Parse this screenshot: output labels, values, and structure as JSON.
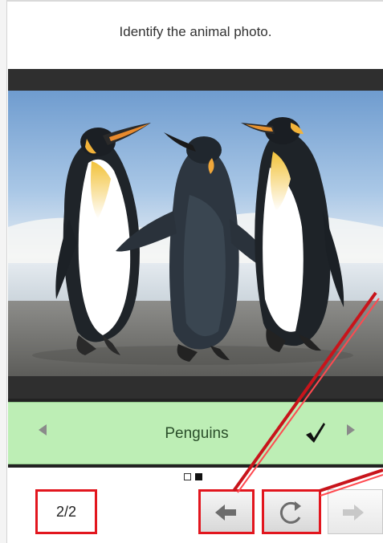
{
  "prompt": "Identify the animal photo.",
  "photo": {
    "subject": "penguins-photo"
  },
  "answer_bar": {
    "label": "Penguins",
    "prev_icon": "triangle-left-icon",
    "next_icon": "triangle-right-icon",
    "check_icon": "checkmark-icon",
    "background": "#bdeeb5"
  },
  "pager": {
    "total_dots": 2,
    "current_dot": 2
  },
  "toolbar": {
    "page_counter": "2/2",
    "back_icon": "arrow-left-icon",
    "reload_icon": "reload-icon",
    "forward_icon": "arrow-right-icon"
  },
  "colors": {
    "highlight": "#e2161e",
    "dark_frame": "#2f2f2f"
  }
}
